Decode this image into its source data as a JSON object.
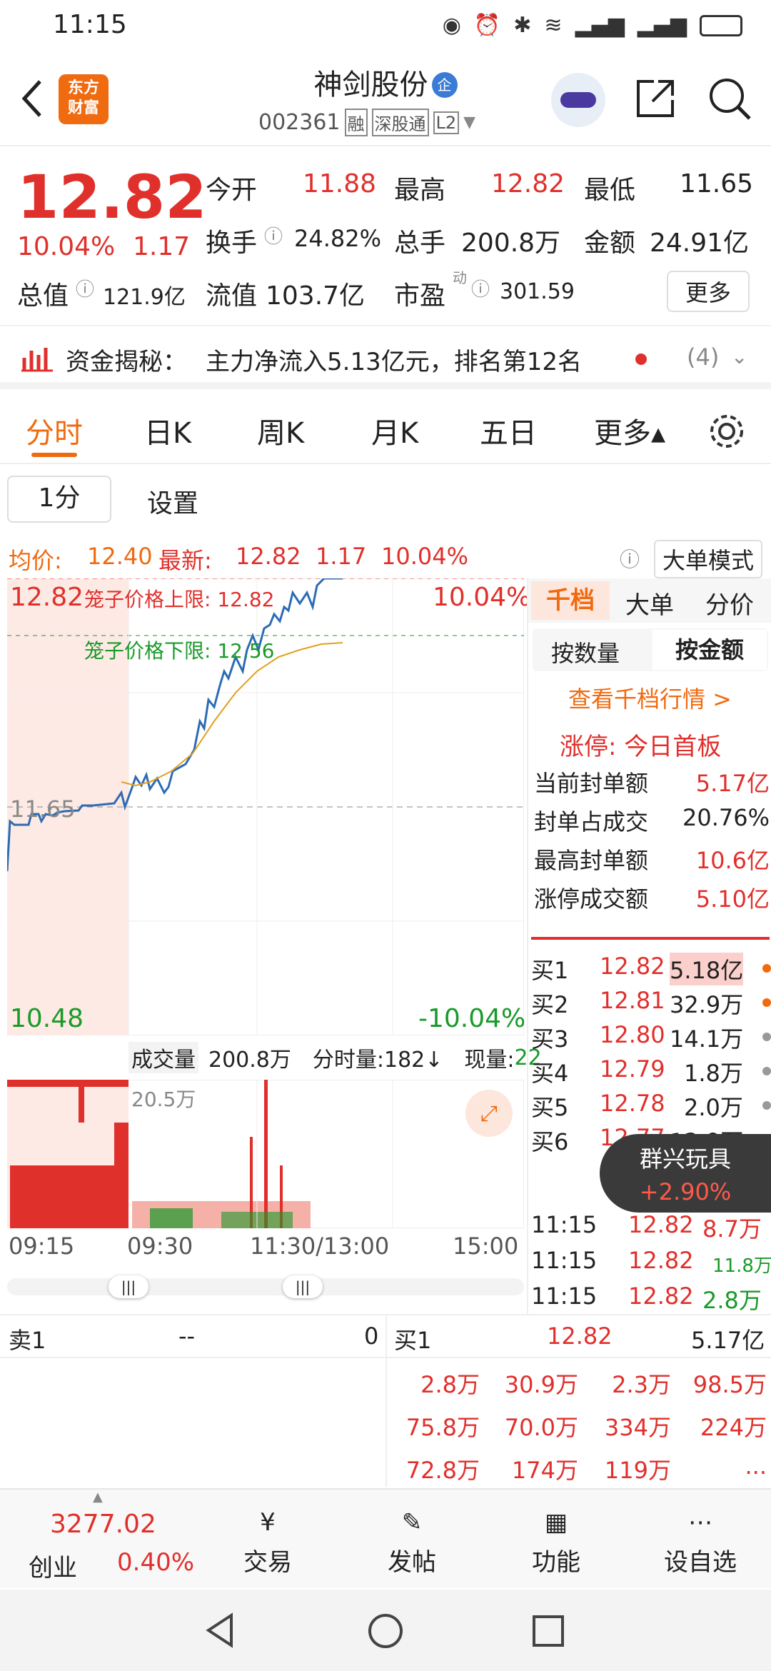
{
  "status": {
    "time": "11:15"
  },
  "header": {
    "logo_line1": "东方",
    "logo_line2": "财富",
    "title": "神剑股份",
    "badge": "企",
    "code": "002361",
    "tag1": "融",
    "tag2": "深股通",
    "tag3": "L2"
  },
  "quote": {
    "price": "12.82",
    "pct": "10.04%",
    "chg": "1.17",
    "open_label": "今开",
    "open": "11.88",
    "high_label": "最高",
    "high": "12.82",
    "low_label": "最低",
    "low": "11.65",
    "turnover_label": "换手",
    "turnover": "24.82%",
    "vol_label": "总手",
    "vol": "200.8万",
    "amt_label": "金额",
    "amt": "24.91亿",
    "mcap_label": "总值",
    "mcap": "121.9亿",
    "float_label": "流值",
    "float": "103.7亿",
    "pe_label": "市盈",
    "pe_sup": "动",
    "pe": "301.59",
    "more": "更多"
  },
  "fund": {
    "label": "资金揭秘：",
    "text": "主力净流入5.13亿元，排名第12名",
    "count": "(4)"
  },
  "tabs": [
    "分时",
    "日K",
    "周K",
    "月K",
    "五日",
    "更多▴"
  ],
  "subtabs": {
    "one_min": "1分",
    "settings": "设置"
  },
  "info_line": {
    "avg_label": "均价:",
    "avg": "12.40",
    "last_label": "最新:",
    "last": "12.82",
    "chg": "1.17",
    "pct": "10.04%",
    "big_mode": "大单模式"
  },
  "chart": {
    "top_price": "12.82",
    "top_pct": "10.04%",
    "bottom_price": "10.48",
    "bottom_pct": "-10.04%",
    "mid_price": "11.65",
    "upper_limit": "笼子价格上限: 12.82",
    "lower_limit": "笼子价格下限: 12.56",
    "vol_label": "成交量",
    "vol_total": "200.8万",
    "minute_vol": "分时量:182↓",
    "now_vol_label": "现量:",
    "now_vol": "22",
    "vol_max": "20.5万",
    "t1": "09:15",
    "t2": "09:30",
    "t3": "11:30/13:00",
    "t4": "15:00"
  },
  "right_panel": {
    "tabs": [
      "千档",
      "大单",
      "分价"
    ],
    "sub": [
      "按数量",
      "按金额"
    ],
    "link": "查看千档行情 >",
    "limit_up": "涨停: 今日首板",
    "stats": [
      [
        "当前封单额",
        "5.17亿"
      ],
      [
        "封单占成交",
        "20.76%"
      ],
      [
        "最高封单额",
        "10.6亿"
      ],
      [
        "涨停成交额",
        "5.10亿"
      ]
    ],
    "bids": [
      [
        "买1",
        "12.82",
        "5.18亿"
      ],
      [
        "买2",
        "12.81",
        "32.9万"
      ],
      [
        "买3",
        "12.80",
        "14.1万"
      ],
      [
        "买4",
        "12.79",
        "1.8万"
      ],
      [
        "买5",
        "12.78",
        "2.0万"
      ],
      [
        "买6",
        "12.77",
        "12.9万"
      ]
    ],
    "ticks": [
      [
        "11:15",
        "12.82",
        "8.7万"
      ],
      [
        "11:15",
        "12.82",
        "11.8万"
      ],
      [
        "11:15",
        "12.82",
        "2.8万"
      ]
    ]
  },
  "popup": {
    "name": "群兴玩具",
    "pct": "+2.90%"
  },
  "queue": {
    "sell_label": "卖1",
    "sell_price": "--",
    "sell_qty": "0",
    "buy_label": "买1",
    "buy_price": "12.82",
    "buy_amt": "5.17亿",
    "rows": [
      [
        "2.8万",
        "30.9万",
        "2.3万",
        "98.5万"
      ],
      [
        "75.8万",
        "70.0万",
        "334万",
        "224万"
      ],
      [
        "72.8万",
        "174万",
        "119万",
        "..."
      ]
    ]
  },
  "bottom": {
    "index_val": "3277.02",
    "index_name": "创业",
    "index_pct": "0.40%",
    "trade": "交易",
    "post": "发帖",
    "func": "功能",
    "watch": "设自选"
  }
}
